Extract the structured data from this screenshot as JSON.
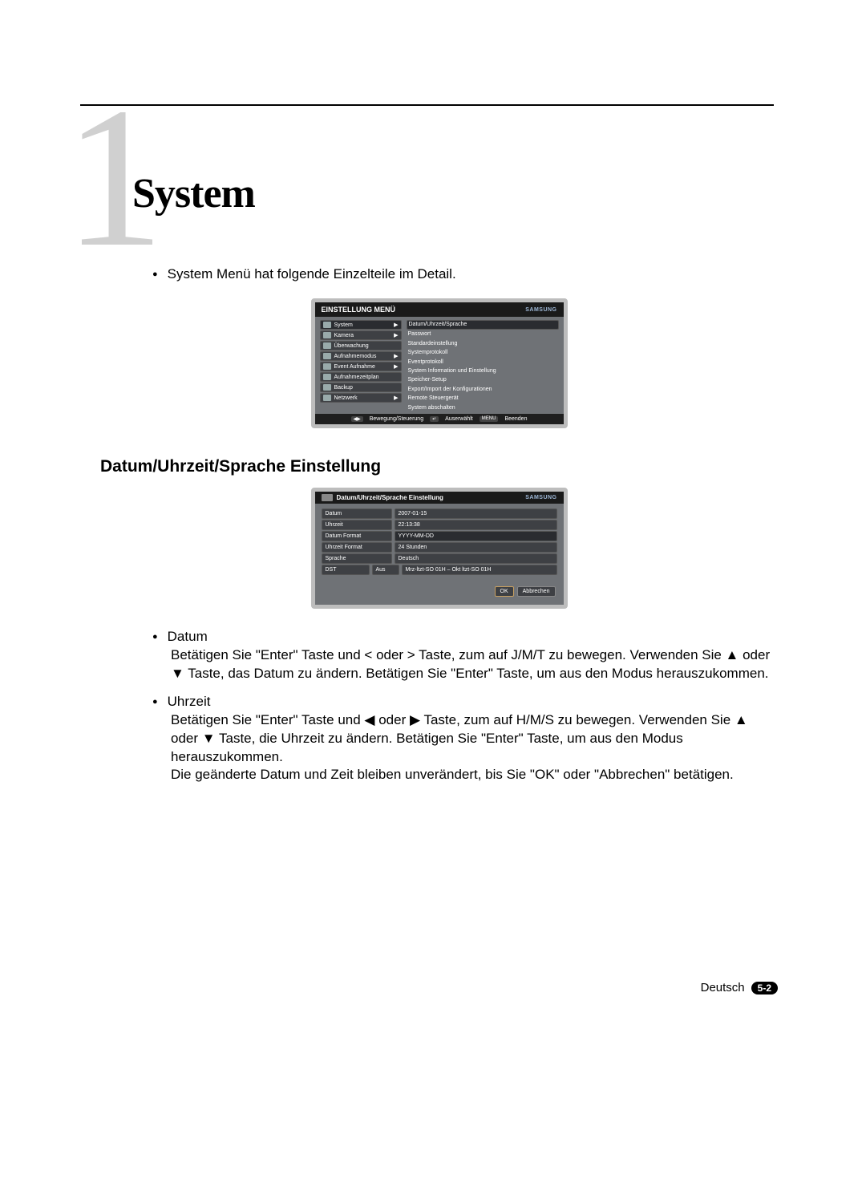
{
  "chapter": {
    "number": "1",
    "title": "System"
  },
  "intro": "System Menü hat folgende Einzelteile im Detail.",
  "menu1": {
    "title": "EINSTELLUNG MENÜ",
    "brand": "SAMSUNG",
    "left": [
      "System",
      "Kamera",
      "Überwachung",
      "Aufnahmemodus",
      "Event Aufnahme",
      "Aufnahmezeitplan",
      "Backup",
      "Netzwerk"
    ],
    "right": [
      "Datum/Uhrzeit/Sprache",
      "Passwort",
      "Standardeinstellung",
      "Systemprotokoll",
      "Eventprotokoll",
      "System Information und Einstellung",
      "Speicher-Setup",
      "Export/Import der Konfigurationen",
      "Remote Steuergerät",
      "System abschalten"
    ],
    "foot": {
      "a": "Bewegung/Steuerung",
      "b": "Auserwählt",
      "c": "Beenden",
      "keyb": "↵",
      "keyc": "MENU"
    }
  },
  "section_h": "Datum/Uhrzeit/Sprache Einstellung",
  "menu2": {
    "title": "Datum/Uhrzeit/Sprache Einstellung",
    "brand": "SAMSUNG",
    "rows": [
      {
        "l": "Datum",
        "r": "2007-01-15"
      },
      {
        "l": "Uhrzeit",
        "r": "22:13:38"
      },
      {
        "l": "Datum Format",
        "r": "YYYY-MM-DD",
        "sel": true
      },
      {
        "l": "Uhrzeit Format",
        "r": "24 Stunden"
      },
      {
        "l": "Sprache",
        "r": "Deutsch"
      }
    ],
    "dst": {
      "l": "DST",
      "m": "Aus",
      "r": "Mrz-ltzt-SO 01H – Okt ltzt-SO 01H"
    },
    "ok": "OK",
    "cancel": "Abbrechen"
  },
  "items": [
    {
      "title": "Datum",
      "body": "Betätigen Sie \"Enter\" Taste und < oder > Taste, zum auf J/M/T zu bewegen. Verwenden Sie ▲ oder ▼ Taste, das Datum zu ändern. Betätigen Sie \"Enter\" Taste, um aus den Modus herauszukommen."
    },
    {
      "title": "Uhrzeit",
      "body": "Betätigen Sie \"Enter\" Taste und ◀ oder ▶ Taste, zum auf H/M/S zu bewegen. Verwenden Sie ▲ oder ▼ Taste, die Uhrzeit zu ändern. Betätigen Sie \"Enter\" Taste, um aus den Modus herauszukommen.\nDie geänderte Datum und Zeit bleiben unverändert, bis Sie \"OK\" oder \"Abbrechen\" betätigen."
    }
  ],
  "footer": {
    "lang": "Deutsch",
    "page": "5-2"
  }
}
